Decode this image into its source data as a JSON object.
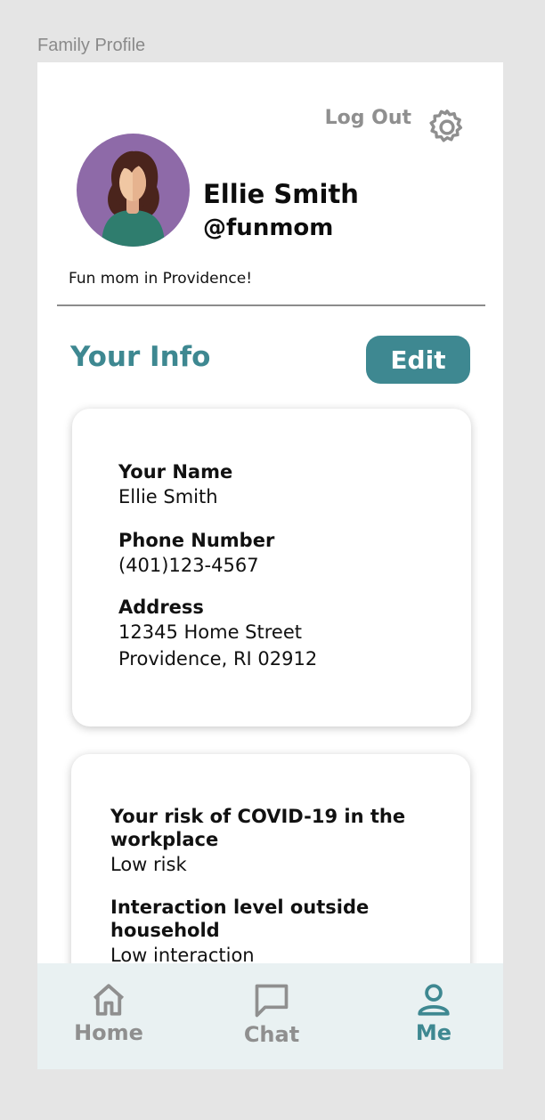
{
  "frame_label": "Family Profile",
  "header": {
    "logout_label": "Log Out",
    "settings_icon": "gear-icon"
  },
  "profile": {
    "name": "Ellie Smith",
    "handle": "@funmom",
    "bio": "Fun mom in Providence!",
    "avatar_bg": "#8e6aa8"
  },
  "info": {
    "title": "Your Info",
    "edit_label": "Edit",
    "fields": [
      {
        "label": "Your Name",
        "value": "Ellie Smith"
      },
      {
        "label": "Phone Number",
        "value": "(401)123-4567"
      },
      {
        "label": "Address",
        "value": "12345 Home Street",
        "value2": "Providence, RI 02912"
      }
    ]
  },
  "risk": {
    "fields": [
      {
        "label": "Your risk of COVID-19 in the",
        "label2": "workplace",
        "value": "Low risk"
      },
      {
        "label": "Interaction level outside",
        "label2": "household",
        "value": "Low interaction"
      }
    ]
  },
  "nav": {
    "items": [
      {
        "label": "Home",
        "icon": "home-icon"
      },
      {
        "label": "Chat",
        "icon": "chat-icon"
      },
      {
        "label": "Me",
        "icon": "person-icon"
      }
    ],
    "active_color": "#3e8891",
    "inactive_color": "#8f8f8f"
  },
  "colors": {
    "accent": "#3e8891",
    "nav_bg": "#e9f1f2"
  }
}
